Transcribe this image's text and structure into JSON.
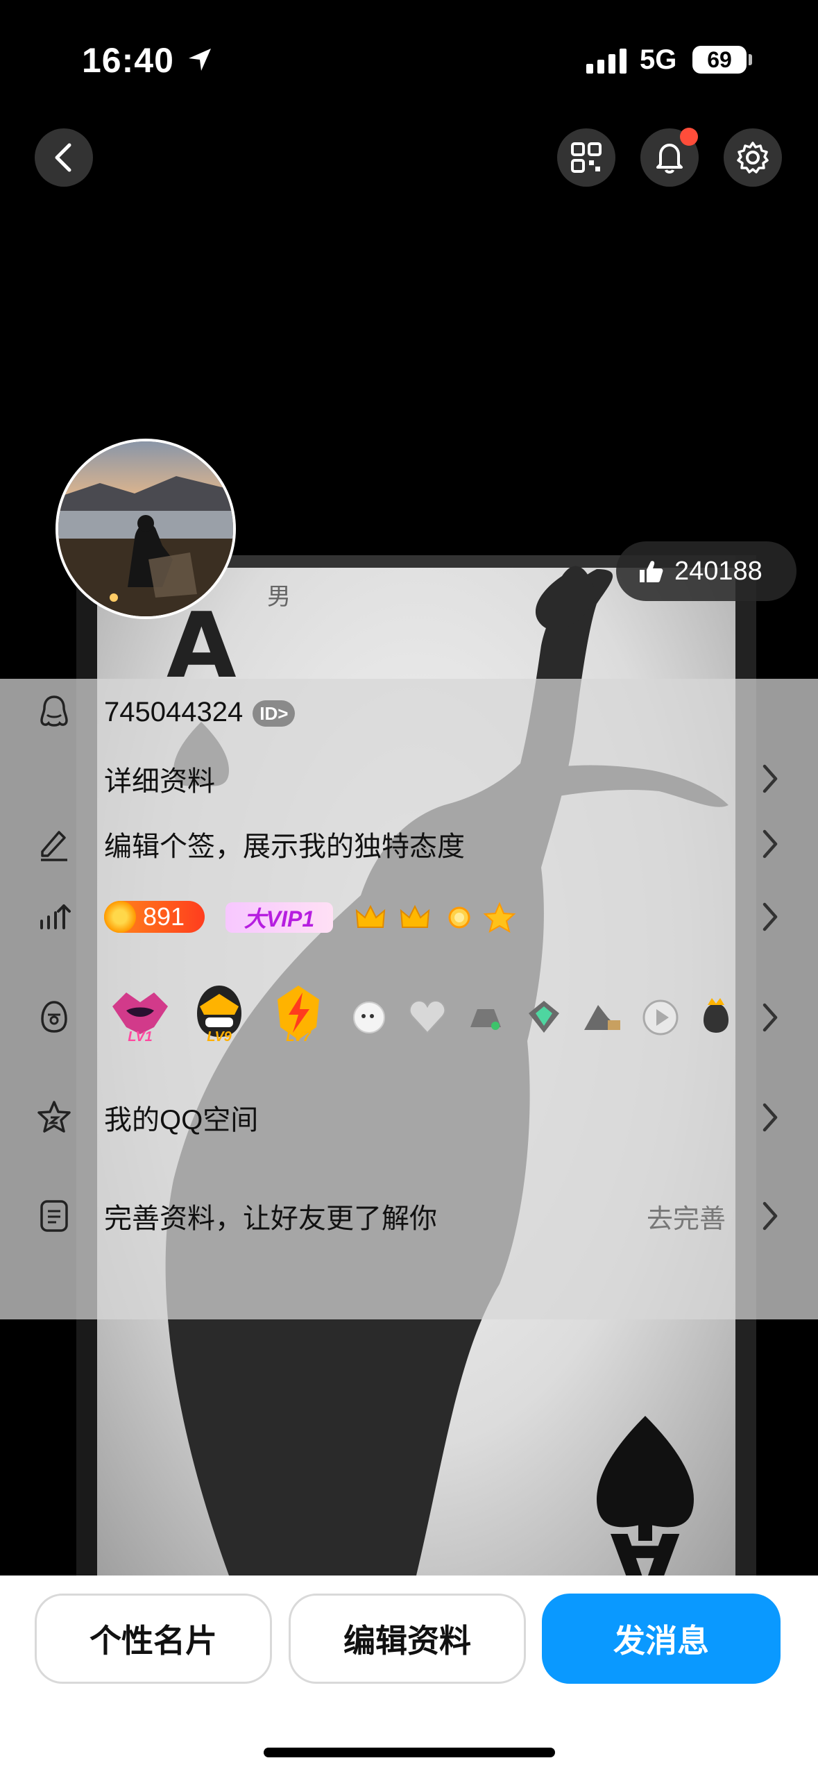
{
  "status_bar": {
    "time": "16:40",
    "network": "5G",
    "battery": "69"
  },
  "header": {
    "back_icon": "chevron-left-icon",
    "qr_icon": "qr-code-icon",
    "bell_icon": "bell-icon",
    "settings_icon": "gear-icon"
  },
  "profile": {
    "gender": "男",
    "likes": "240188"
  },
  "rows": {
    "qq_number": "745044324",
    "id_badge": "ID>",
    "detail": "详细资料",
    "signature": "编辑个签，展示我的独特态度",
    "coins": "891",
    "vip": "大VIP1",
    "qzone": "我的QQ空间",
    "complete": "完善资料，让好友更了解你",
    "complete_hint": "去完善"
  },
  "level_badges": [
    "LV1",
    "LV9",
    "LV7"
  ],
  "buttons": {
    "card": "个性名片",
    "edit": "编辑资料",
    "message": "发消息"
  },
  "colors": {
    "accent": "#0a99ff",
    "notification": "#ff4d3a",
    "coin": "#ff5a1e"
  }
}
